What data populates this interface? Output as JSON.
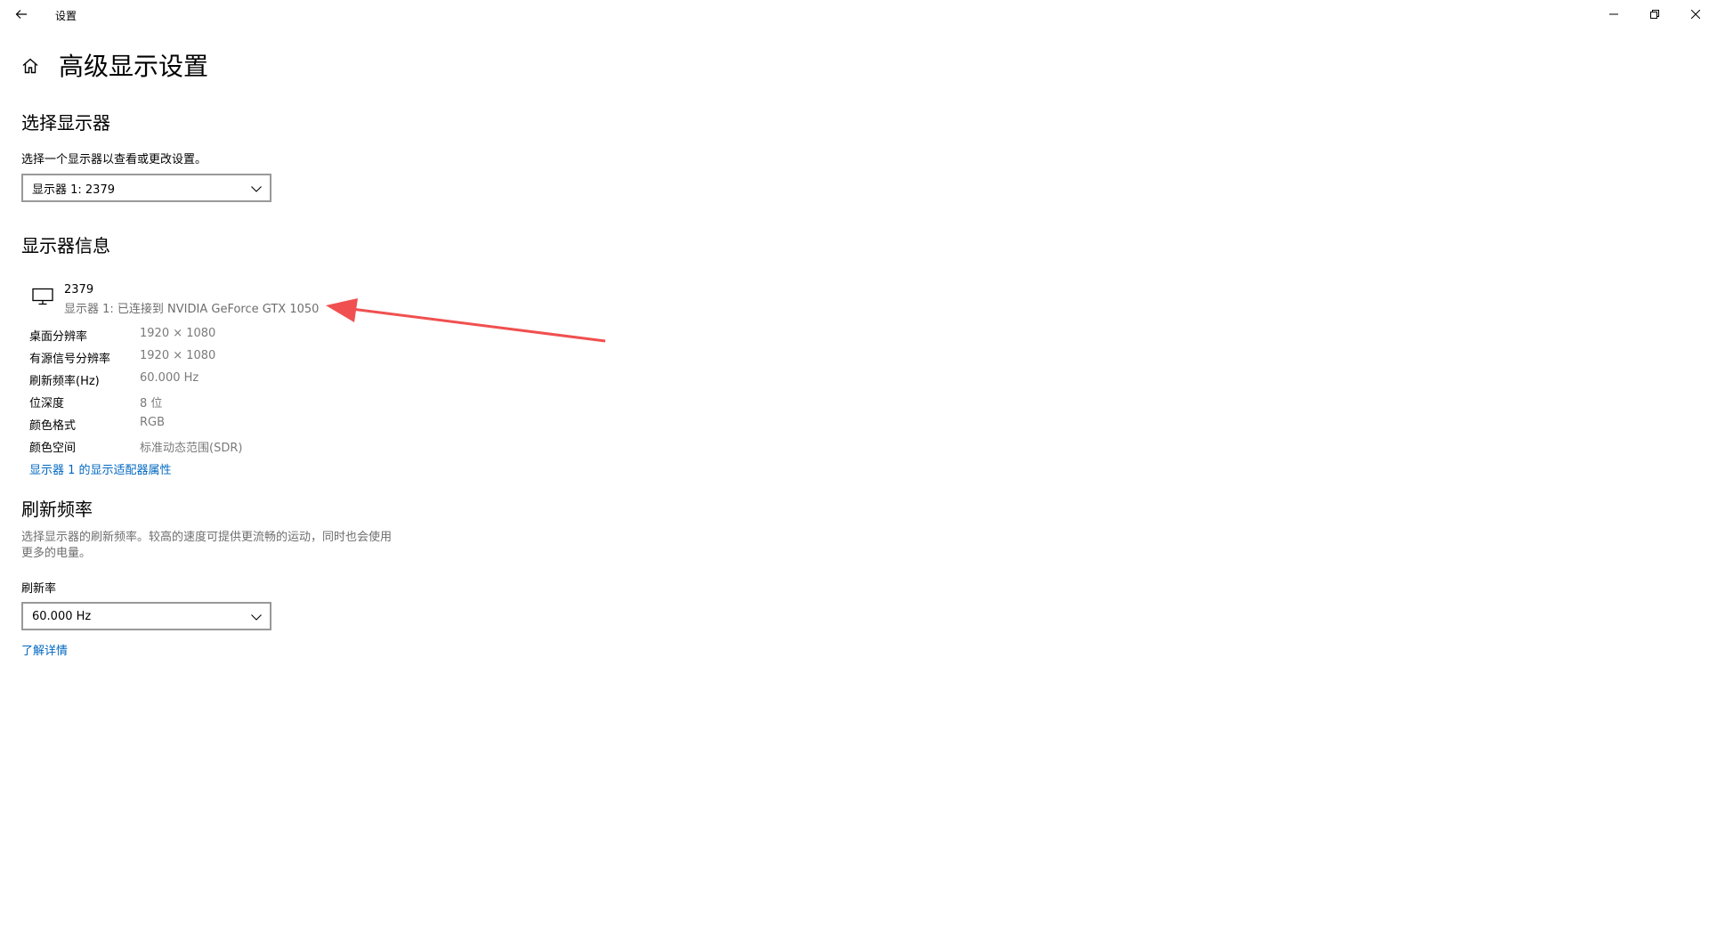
{
  "window": {
    "title": "设置",
    "controls": [
      "minimize",
      "restore",
      "close"
    ]
  },
  "page": {
    "title": "高级显示设置"
  },
  "select_display": {
    "title": "选择显示器",
    "description": "选择一个显示器以查看或更改设置。",
    "selected": "显示器 1: 2379"
  },
  "display_info": {
    "title": "显示器信息",
    "monitor_name": "2379",
    "monitor_sub": "显示器 1: 已连接到 NVIDIA GeForce GTX 1050",
    "rows": [
      {
        "key": "桌面分辨率",
        "value": "1920 × 1080"
      },
      {
        "key": "有源信号分辨率",
        "value": "1920 × 1080"
      },
      {
        "key": "刷新频率(Hz)",
        "value": "60.000 Hz"
      },
      {
        "key": "位深度",
        "value": "8 位"
      },
      {
        "key": "颜色格式",
        "value": "RGB"
      },
      {
        "key": "颜色空间",
        "value": "标准动态范围(SDR)"
      }
    ],
    "adapter_link": "显示器 1 的显示适配器属性"
  },
  "refresh": {
    "title": "刷新频率",
    "description_line1": "选择显示器的刷新频率。较高的速度可提供更流畅的运动，同时也会使用",
    "description_line2": "更多的电量。",
    "label": "刷新率",
    "selected": "60.000 Hz",
    "learn_more": "了解详情"
  },
  "colors": {
    "accent_link": "#0067c0",
    "annotation_arrow": "#f05050"
  }
}
